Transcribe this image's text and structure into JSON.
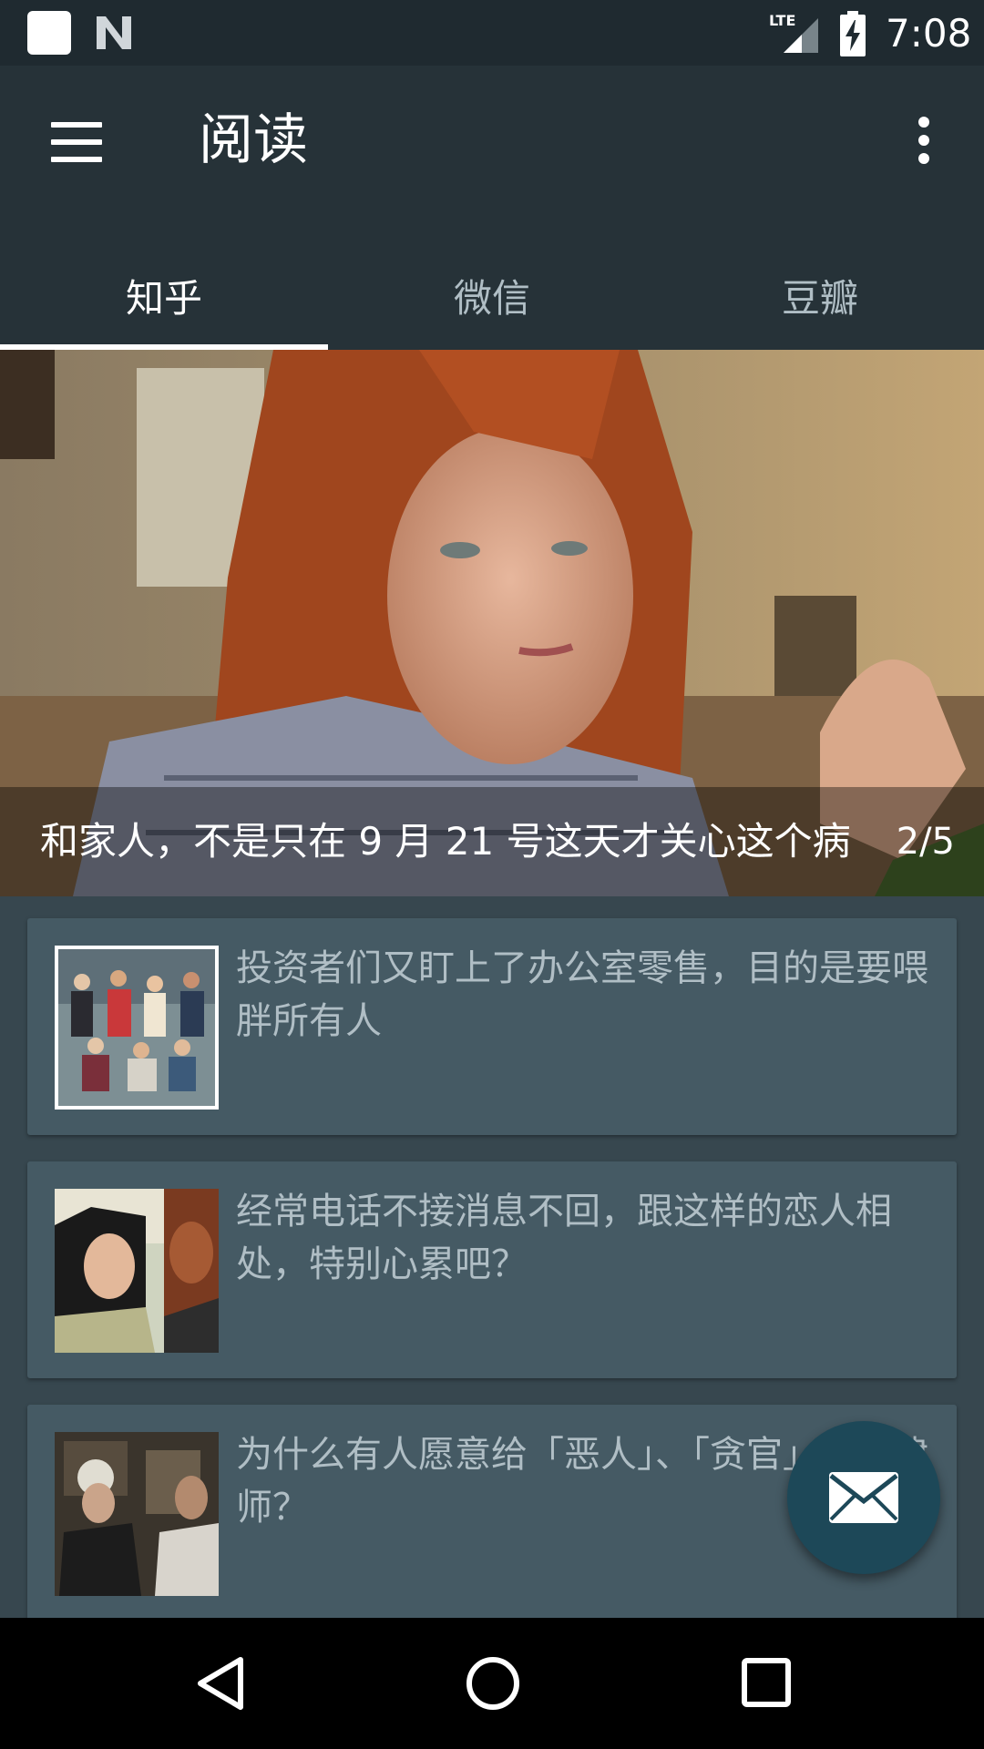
{
  "status_bar": {
    "time": "7:08",
    "network": "LTE"
  },
  "app_bar": {
    "title": "阅读"
  },
  "tabs": [
    {
      "label": "知乎",
      "active": true
    },
    {
      "label": "微信",
      "active": false
    },
    {
      "label": "豆瓣",
      "active": false
    }
  ],
  "banner": {
    "caption": "和家人，不是只在 9 月 21 号这天才关心这个病",
    "counter": "2/5"
  },
  "articles": [
    {
      "title": "投资者们又盯上了办公室零售，目的是要喂胖所有人",
      "thumb": "group-photo"
    },
    {
      "title": "经常电话不接消息不回，跟这样的恋人相处，特别心累吧？",
      "thumb": "couple-photo"
    },
    {
      "title": "为什么有人愿意给「恶人」、「贪官」辩护律师？",
      "thumb": "office-photo"
    }
  ],
  "fab": {
    "icon": "mail-icon"
  },
  "colors": {
    "app_bar": "#263238",
    "background": "#37474f",
    "card": "#455a64",
    "fab": "#1d4858"
  }
}
